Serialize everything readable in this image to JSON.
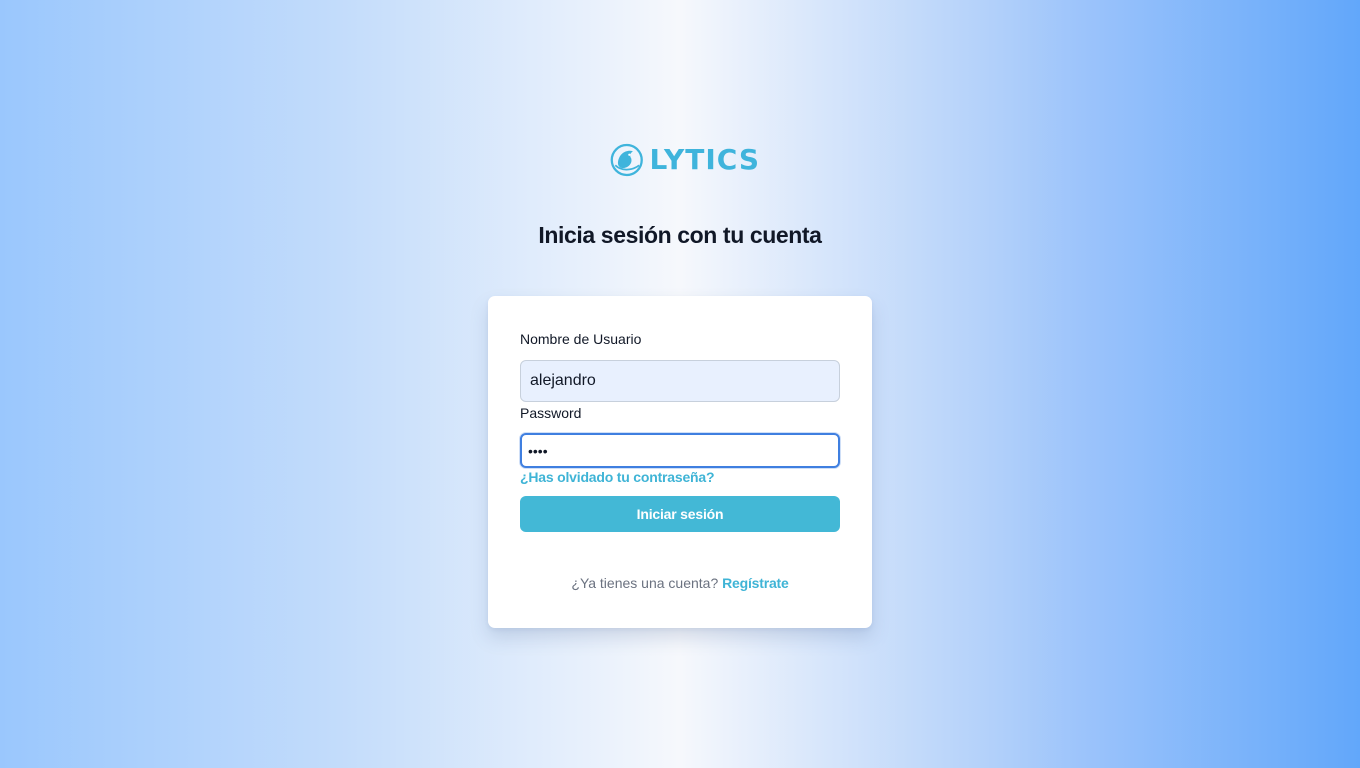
{
  "brand": {
    "name": "LYTICS",
    "logo_icon": "globe-bird-icon",
    "color": "#3fb4dc"
  },
  "heading": "Inicia sesión con tu cuenta",
  "form": {
    "username_label": "Nombre de Usuario",
    "username_value": "alejandro",
    "password_label": "Password",
    "password_value": "••••",
    "forgot_link": "¿Has olvidado tu contraseña?",
    "submit_label": "Iniciar sesión"
  },
  "footer": {
    "prompt": "¿Ya tienes una cuenta?",
    "register_link": "Regístrate"
  },
  "colors": {
    "accent": "#43b8d6",
    "focus_border": "#3f7fe0",
    "autofill_bg": "#e8f0fe"
  }
}
